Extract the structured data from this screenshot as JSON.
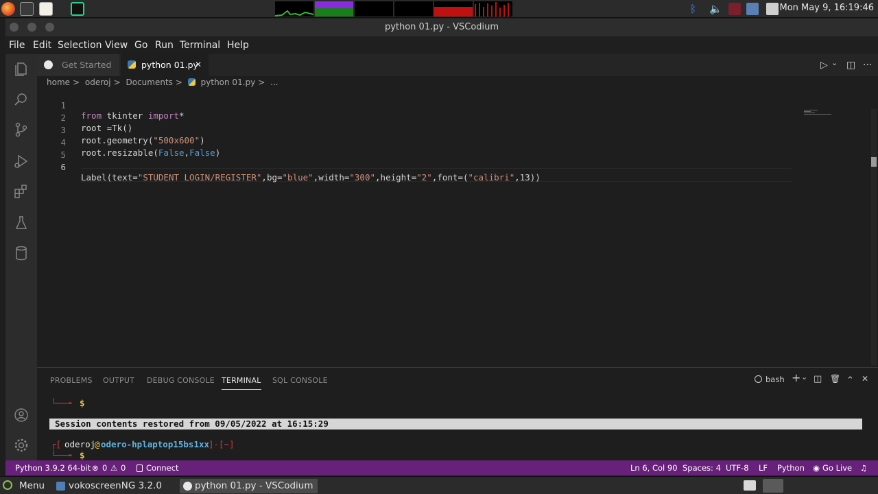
{
  "system": {
    "clock": "Mon May 9, 16:19:46"
  },
  "window": {
    "title": "python 01.py - VSCodium"
  },
  "menu": [
    "File",
    "Edit",
    "Selection",
    "View",
    "Go",
    "Run",
    "Terminal",
    "Help"
  ],
  "tabs": [
    {
      "label": "Get Started"
    },
    {
      "label": "python 01.py",
      "close": "✕"
    }
  ],
  "editor_actions": {
    "run": "▷",
    "run_menu": "⌄",
    "split": "◫",
    "more": "···"
  },
  "breadcrumb": {
    "parts": [
      "home",
      "oderoj",
      "Documents",
      "python 01.py",
      "..."
    ],
    "sep": ">"
  },
  "code": {
    "line_numbers": [
      "1",
      "2",
      "3",
      "4",
      "5",
      "6"
    ],
    "l1": {
      "kw1": "from",
      "mod": " tkinter ",
      "kw2": "import",
      "rest": "*"
    },
    "l2": {
      "text": "root =Tk()"
    },
    "l3": {
      "pre": "root.geometry(",
      "str": "\"500x600\"",
      "post": ")"
    },
    "l4": {
      "pre": "root.resizable(",
      "c1": "False",
      "comma": ",",
      "c2": "False",
      "post": ")"
    },
    "l6": {
      "p1": "Label(text=",
      "s1": "\"STUDENT LOGIN/REGISTER\"",
      "p2": ",bg=",
      "s2": "\"blue\"",
      "p3": ",width=",
      "s3": "\"300\"",
      "p4": ",height=",
      "s4": "\"2\"",
      "p5": ",font=(",
      "s5": "\"calibri\"",
      "p6": ",13))"
    }
  },
  "panel": {
    "tabs": [
      "PROBLEMS",
      "OUTPUT",
      "DEBUG CONSOLE",
      "TERMINAL",
      "SQL CONSOLE"
    ],
    "active_tab": "TERMINAL",
    "shell": "bash",
    "actions": {
      "add": "+",
      "add_menu": "⌄",
      "split": "◫",
      "trash": "🗑",
      "maximize": "⌃",
      "close": "✕"
    },
    "terminal": {
      "prompt1_branch": "└──╼",
      "prompt1_sym": "$",
      "banner": "Session contents restored from 09/05/2022 at 16:15:29",
      "prompt2_open": "┌[",
      "user": "oderoj",
      "at": "@",
      "host": "odero-hplaptop15bs1xx",
      "dir_part": "]-[~]",
      "prompt3_branch": "└──╼",
      "prompt3_sym": "$"
    }
  },
  "statusbar": {
    "python": "Python 3.9.2 64-bit",
    "errors": "0",
    "warnings": "0",
    "connect": "Connect",
    "position": "Ln 6, Col 90",
    "spaces": "Spaces: 4",
    "encoding": "UTF-8",
    "eol": "LF",
    "language": "Python",
    "golive": "Go Live"
  },
  "taskbar": {
    "menu": "Menu",
    "items": [
      "vokoscreenNG 3.2.0",
      "python 01.py - VSCodium"
    ]
  },
  "colors": {
    "statusbar": "#68217a",
    "keyword": "#c586c0",
    "string": "#ce9178",
    "constant": "#569cd6"
  }
}
